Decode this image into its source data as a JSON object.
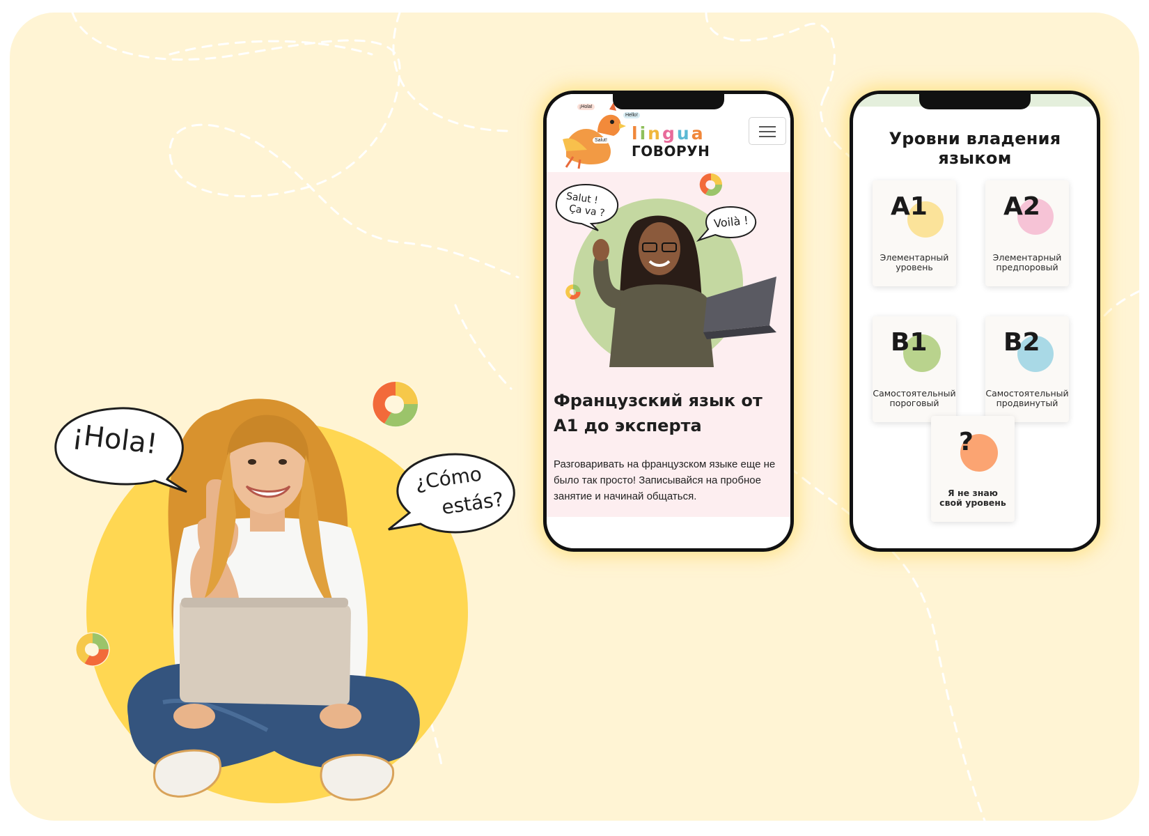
{
  "colors": {
    "background": "#fff4d4",
    "hero_circle": "#ffd752",
    "hero_pink": "#fdeef0",
    "a1_dot": "#fbe39a",
    "a2_dot": "#f6c3d6",
    "b1_dot": "#b9d38d",
    "b2_dot": "#a9d9e6",
    "unknown_dot": "#fba472"
  },
  "hero": {
    "bubble_hola": "¡Hola!",
    "bubble_como_line1": "¿Cómo",
    "bubble_como_line2": "estás?"
  },
  "phone1": {
    "logo_word": "lingua",
    "logo_letters": [
      "l",
      "i",
      "n",
      "g",
      "u",
      "a"
    ],
    "brand_name": "ГОВОРУН",
    "mascot_tags": [
      "¡Hola!",
      "Hello!",
      "Salut!"
    ],
    "menu_icon": "hamburger-menu-icon",
    "bubble_salut_line1": "Salut !",
    "bubble_salut_line2": "Ça va ?",
    "bubble_voila": "Voilà !",
    "title": "Французский язык от А1 до эксперта",
    "description": "Разговаривать на французском языке еще не было так просто! Записывайся на пробное занятие и начинай общаться."
  },
  "phone2": {
    "title": "Уровни владения языком",
    "levels": [
      {
        "code": "A1",
        "label_line1": "Элементарный",
        "label_line2": "уровень"
      },
      {
        "code": "A2",
        "label_line1": "Элементарный",
        "label_line2": "предпоровый"
      },
      {
        "code": "B1",
        "label_line1": "Самостоятельный",
        "label_line2": "пороговый"
      },
      {
        "code": "B2",
        "label_line1": "Самостоятельный",
        "label_line2": "продвинутый"
      },
      {
        "code": "?",
        "label_line1": "Я не знаю",
        "label_line2": "свой уровень"
      }
    ]
  }
}
